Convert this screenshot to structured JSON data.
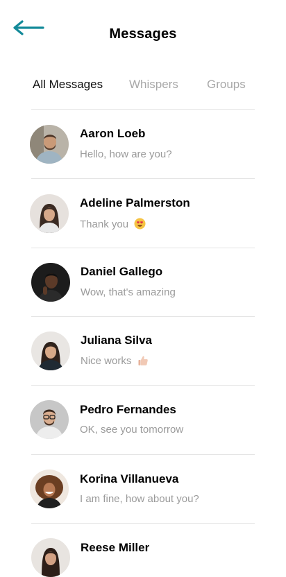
{
  "header": {
    "title": "Messages",
    "accent_color": "#138a99",
    "back_icon": "arrow-left-icon"
  },
  "tabs": [
    {
      "label": "All Messages",
      "active": true
    },
    {
      "label": "Whispers",
      "active": false
    },
    {
      "label": "Groups",
      "active": false
    }
  ],
  "conversations": [
    {
      "name": "Aaron Loeb",
      "preview": "Hello, how are you?",
      "emoji": null
    },
    {
      "name": "Adeline Palmerston",
      "preview": "Thank you",
      "emoji": "heart-eyes-emoji"
    },
    {
      "name": "Daniel Gallego",
      "preview": "Wow, that's amazing",
      "emoji": null
    },
    {
      "name": "Juliana Silva",
      "preview": "Nice works",
      "emoji": "thumbs-up-emoji"
    },
    {
      "name": "Pedro Fernandes",
      "preview": "OK, see you tomorrow",
      "emoji": null
    },
    {
      "name": "Korina Villanueva",
      "preview": "I am fine, how about you?",
      "emoji": null
    },
    {
      "name": "Reese Miller",
      "preview": "",
      "emoji": null
    }
  ]
}
